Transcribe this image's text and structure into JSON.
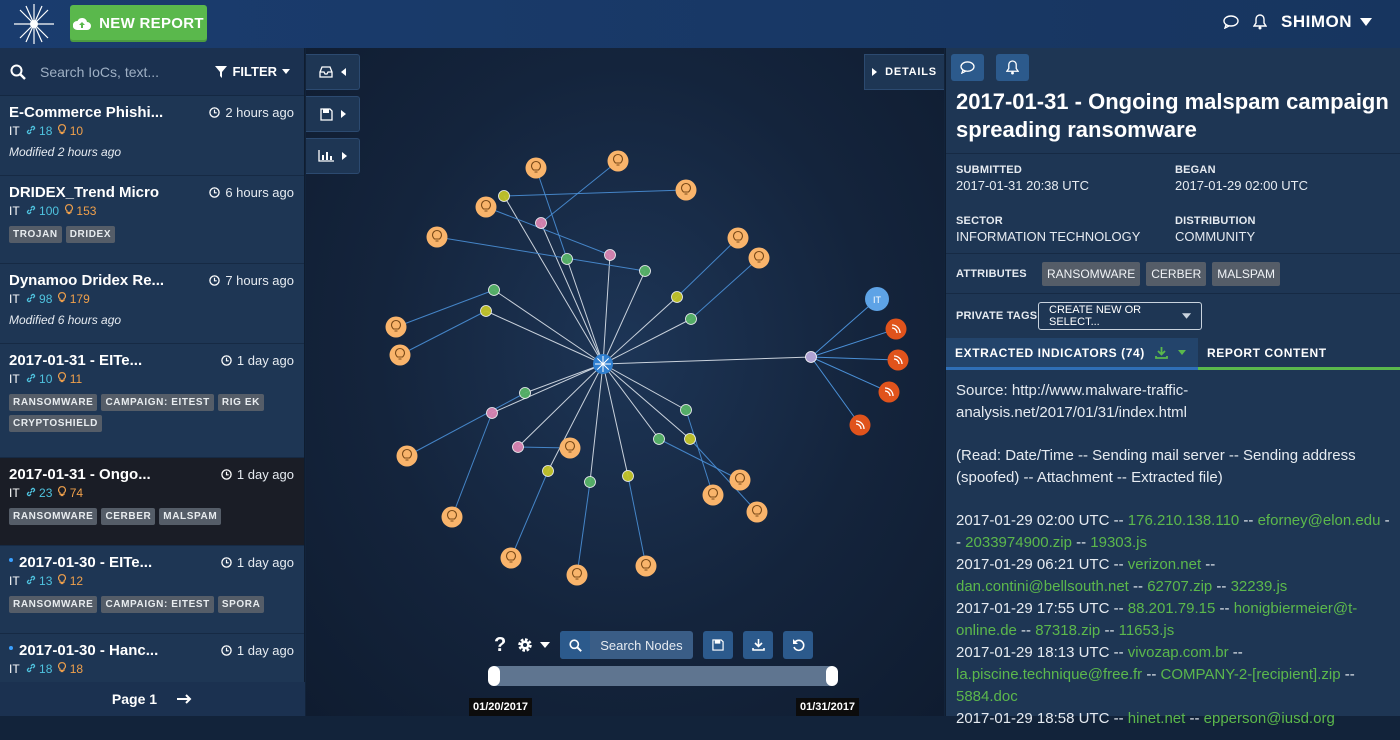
{
  "header": {
    "new_report_label": "NEW REPORT",
    "user_name": "SHIMON"
  },
  "sidebar": {
    "search_placeholder": "Search IoCs, text...",
    "filter_label": "FILTER",
    "reports": [
      {
        "title": "E-Commerce Phishi...",
        "time": "2 hours ago",
        "sector": "IT",
        "links": "18",
        "indicators": "10",
        "modified": "Modified 2 hours ago",
        "tags": []
      },
      {
        "title": "DRIDEX_Trend Micro",
        "time": "6 hours ago",
        "sector": "IT",
        "links": "100",
        "indicators": "153",
        "modified": "",
        "tags": [
          "TROJAN",
          "DRIDEX"
        ]
      },
      {
        "title": "Dynamoo Dridex Re...",
        "time": "7 hours ago",
        "sector": "IT",
        "links": "98",
        "indicators": "179",
        "modified": "Modified 6 hours ago",
        "tags": []
      },
      {
        "title": "2017-01-31 - EITe...",
        "time": "1 day ago",
        "sector": "IT",
        "links": "10",
        "indicators": "11",
        "modified": "",
        "tags": [
          "RANSOMWARE",
          "CAMPAIGN: EITEST",
          "RIG EK",
          "CRYPTOSHIELD"
        ]
      },
      {
        "title": "2017-01-31 - Ongo...",
        "time": "1 day ago",
        "sector": "IT",
        "links": "23",
        "indicators": "74",
        "modified": "",
        "tags": [
          "RANSOMWARE",
          "CERBER",
          "MALSPAM"
        ]
      },
      {
        "title": "2017-01-30 - EITe...",
        "time": "1 day ago",
        "sector": "IT",
        "links": "13",
        "indicators": "12",
        "modified": "",
        "tags": [
          "RANSOMWARE",
          "CAMPAIGN: EITEST",
          "SPORA"
        ]
      },
      {
        "title": "2017-01-30 - Hanc...",
        "time": "1 day ago",
        "sector": "IT",
        "links": "18",
        "indicators": "18",
        "modified": "",
        "tags": []
      }
    ],
    "page_label": "Page 1"
  },
  "graph": {
    "details_label": "DETAILS",
    "center_label": "IT",
    "search_nodes_label": "Search Nodes",
    "timeline_start": "01/20/2017",
    "timeline_end": "01/31/2017"
  },
  "details": {
    "title": "2017-01-31 - Ongoing malspam campaign spreading ransomware",
    "submitted_label": "SUBMITTED",
    "submitted_value": "2017-01-31 20:38 UTC",
    "began_label": "BEGAN",
    "began_value": "2017-01-29 02:00 UTC",
    "sector_label": "SECTOR",
    "sector_value": "INFORMATION TECHNOLOGY",
    "distribution_label": "DISTRIBUTION",
    "distribution_value": "COMMUNITY",
    "attributes_label": "ATTRIBUTES",
    "attributes": [
      "RANSOMWARE",
      "CERBER",
      "MALSPAM"
    ],
    "private_tags_label": "PRIVATE TAGS",
    "private_tags_select": "CREATE NEW OR SELECT...",
    "tab_indicators": "EXTRACTED INDICATORS (74)",
    "tab_content": "REPORT CONTENT",
    "source_line": "Source: http://www.malware-traffic-analysis.net/2017/01/31/index.html",
    "read_line": "(Read: Date/Time -- Sending mail server -- Sending address (spoofed) -- Attachment -- Extracted file)",
    "entries": [
      {
        "time": "2017-01-29 02:00 UTC",
        "server": "176.210.138.110",
        "sender": "eforney@elon.edu",
        "attachment": "2033974900.zip",
        "file": "19303.js"
      },
      {
        "time": "2017-01-29 06:21 UTC",
        "server": "verizon.net",
        "sender": "dan.contini@bellsouth.net",
        "attachment": "62707.zip",
        "file": "32239.js"
      },
      {
        "time": "2017-01-29 17:55 UTC",
        "server": "88.201.79.15",
        "sender": "honigbiermeier@t-online.de",
        "attachment": "87318.zip",
        "file": "11653.js"
      },
      {
        "time": "2017-01-29 18:13 UTC",
        "server": "vivozap.com.br",
        "sender": "la.piscine.technique@free.fr",
        "attachment": "COMPANY-2-[recipient].zip",
        "file": "5884.doc"
      },
      {
        "time": "2017-01-29 18:58 UTC",
        "server": "hinet.net",
        "sender": "epperson@iusd.org",
        "attachment": "",
        "file": ""
      }
    ]
  },
  "colors": {
    "accent_green": "#5ab84c",
    "link_green": "#5cb84c",
    "topbar": "#1a3c6e",
    "node_orange": "#f9b46b",
    "node_red": "#e0531c"
  }
}
